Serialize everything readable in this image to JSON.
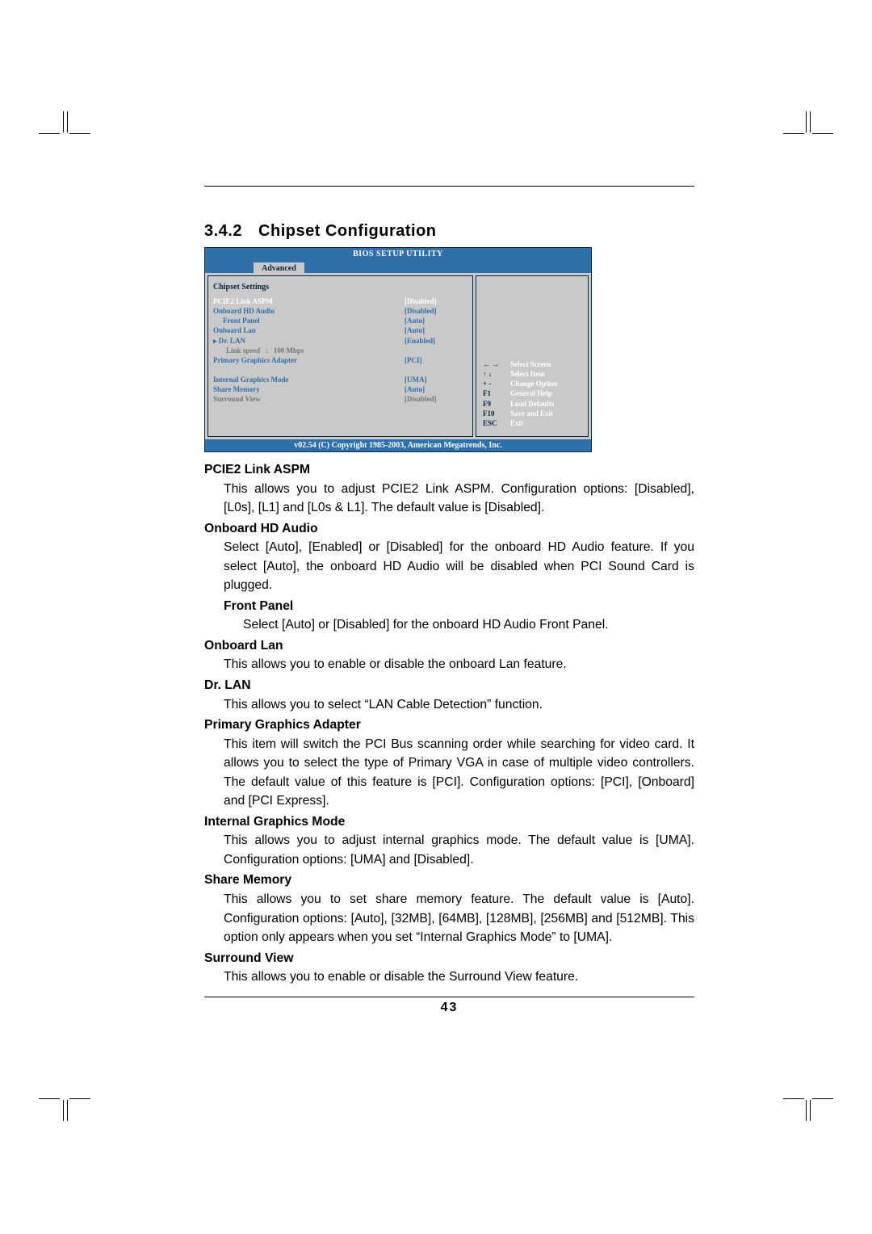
{
  "section": {
    "number": "3.4.2",
    "title": "Chipset Configuration"
  },
  "page_number": "43",
  "bios": {
    "title": "BIOS SETUP UTILITY",
    "tab": "Advanced",
    "panel_title": "Chipset Settings",
    "rows": [
      {
        "label": "PCIE2 Link ASPM",
        "value": "[Disabled]",
        "style": "white"
      },
      {
        "label": "Onboard HD Audio",
        "value": "[Disabled]",
        "style": "blue"
      },
      {
        "label": "Front Panel",
        "value": "[Auto]",
        "style": "blue",
        "indent": 1
      },
      {
        "label": "Onboard Lan",
        "value": "[Auto]",
        "style": "blue"
      },
      {
        "label": "▸ Dr. LAN",
        "value": "[Enabled]",
        "style": "blue"
      },
      {
        "label": "Link speed   :   100 Mbps",
        "value": "",
        "style": "gray",
        "indent": 2
      },
      {
        "label": "Primary Graphics Adapter",
        "value": "[PCI]",
        "style": "blue"
      },
      {
        "label": " ",
        "value": "",
        "style": "blue"
      },
      {
        "label": "Internal Graphics Mode",
        "value": "[UMA]",
        "style": "blue"
      },
      {
        "label": "Share Memory",
        "value": "[Auto]",
        "style": "blue"
      },
      {
        "label": "Surround View",
        "value": "[Disabled]",
        "style": "gray"
      }
    ],
    "help": [
      {
        "key": "← →",
        "text": "Select Screen"
      },
      {
        "key": "↑ ↓",
        "text": "Select Item"
      },
      {
        "key": "+ -",
        "text": "Change Option"
      },
      {
        "key": "F1",
        "text": "General Help"
      },
      {
        "key": "F9",
        "text": "Load Defaults"
      },
      {
        "key": "F10",
        "text": "Save and Exit"
      },
      {
        "key": "ESC",
        "text": "Exit"
      }
    ],
    "footer": "v02.54 (C) Copyright 1985-2003, American Megatrends, Inc."
  },
  "desc": {
    "pcie2_h": "PCIE2 Link ASPM",
    "pcie2_p": "This allows you to adjust PCIE2 Link ASPM. Configuration options: [Disabled], [L0s], [L1] and [L0s & L1]. The default value is [Disabled].",
    "hdaudio_h": "Onboard HD Audio",
    "hdaudio_p": "Select [Auto], [Enabled] or [Disabled] for the onboard HD Audio feature. If you select [Auto], the onboard HD Audio will be disabled when PCI Sound Card is plugged.",
    "front_h": "Front Panel",
    "front_p": "Select [Auto] or [Disabled] for the onboard HD Audio Front Panel.",
    "lan_h": "Onboard Lan",
    "lan_p": "This allows you to enable or disable the onboard Lan feature.",
    "drlan_h": "Dr. LAN",
    "drlan_p": "This allows you to select “LAN Cable Detection” function.",
    "pga_h": "Primary Graphics Adapter",
    "pga_p": "This item will switch the PCI Bus scanning order while searching for video card. It allows you to select the type of Primary VGA in case of multiple video controllers. The default value of this feature is [PCI]. Configuration options: [PCI], [Onboard] and [PCI Express].",
    "igm_h": "Internal Graphics Mode",
    "igm_p": "This allows you to adjust internal graphics mode. The default value is [UMA]. Configuration options: [UMA] and [Disabled].",
    "sm_h": "Share Memory",
    "sm_p": "This allows you to set share memory feature. The default value is [Auto]. Configuration options: [Auto], [32MB], [64MB], [128MB], [256MB] and [512MB]. This option only appears when you set “Internal Graphics Mode” to [UMA].",
    "sv_h": "Surround View",
    "sv_p": "This allows you to enable or disable the Surround View feature."
  }
}
